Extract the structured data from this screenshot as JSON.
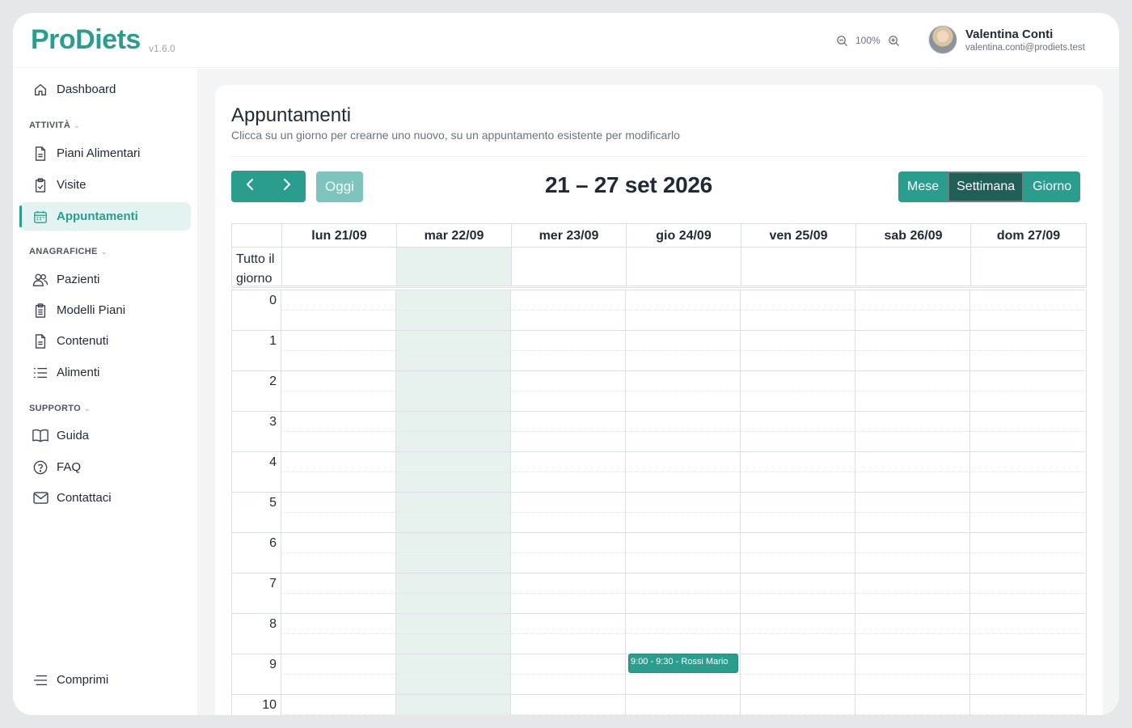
{
  "app": {
    "name": "ProDiets",
    "version": "v1.6.0"
  },
  "header": {
    "zoom_level": "100%",
    "user_name": "Valentina Conti",
    "user_email": "valentina.conti@prodiets.test"
  },
  "sidebar": {
    "dashboard": "Dashboard",
    "section_activities": "ATTIVITÀ",
    "piani": "Piani Alimentari",
    "visite": "Visite",
    "appuntamenti": "Appuntamenti",
    "section_registry": "ANAGRAFICHE",
    "pazienti": "Pazienti",
    "modelli": "Modelli Piani",
    "contenuti": "Contenuti",
    "alimenti": "Alimenti",
    "section_support": "SUPPORTO",
    "guida": "Guida",
    "faq": "FAQ",
    "contattaci": "Contattaci",
    "collapse": "Comprimi"
  },
  "page": {
    "title": "Appuntamenti",
    "subtitle": "Clicca su un giorno per crearne uno nuovo, su un appuntamento esistente per modificarlo"
  },
  "calendar": {
    "today_label": "Oggi",
    "range_title": "21 – 27 set 2026",
    "views": [
      "Mese",
      "Settimana",
      "Giorno"
    ],
    "active_view": "Settimana",
    "all_day_label": "Tutto il giorno",
    "days": [
      "lun 21/09",
      "mar 22/09",
      "mer 23/09",
      "gio 24/09",
      "ven 25/09",
      "sab 26/09",
      "dom 27/09"
    ],
    "today_index": 1,
    "hours": [
      "0",
      "1",
      "2",
      "3",
      "4",
      "5",
      "6",
      "7",
      "8",
      "9",
      "10"
    ],
    "event": {
      "label": "9:00 - 9:30 - Rossi Mario",
      "day": "gio 24/09",
      "start": "9:00",
      "end": "9:30"
    }
  },
  "colors": {
    "accent": "#2a9d8f",
    "accent_dark": "#1f5f57",
    "today_bg": "#e7f2ef"
  }
}
